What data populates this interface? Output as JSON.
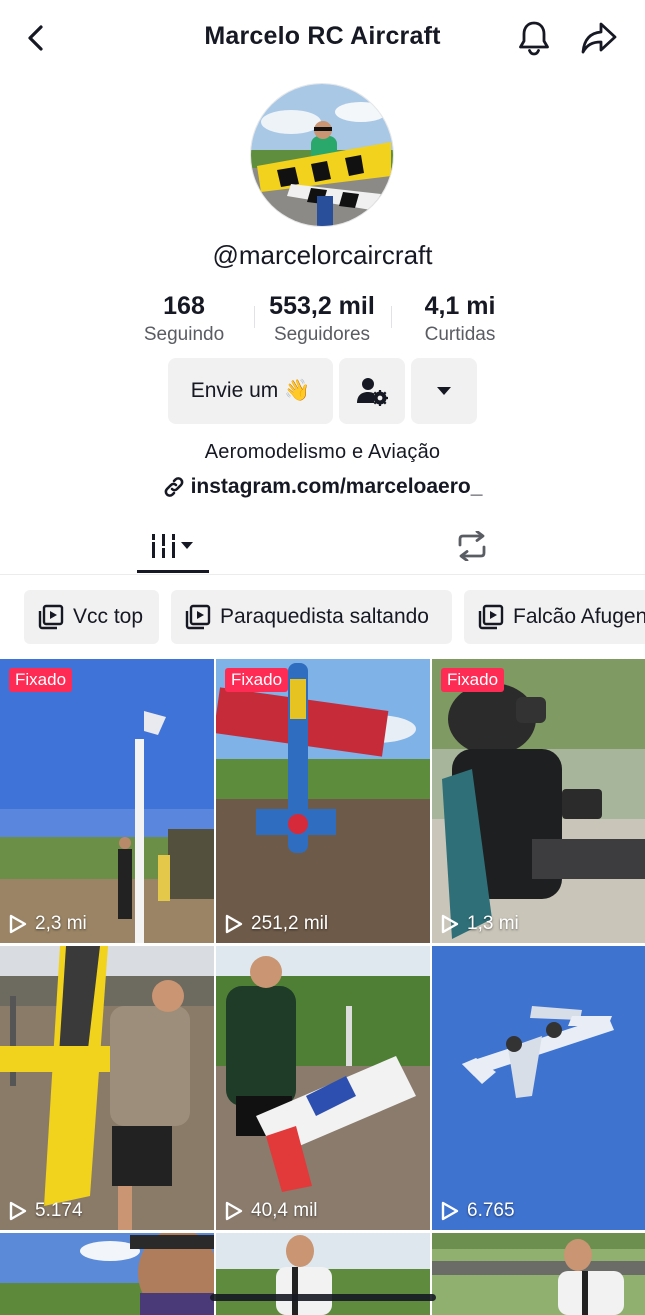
{
  "header": {
    "title": "Marcelo RC Aircraft",
    "back_icon": "chevron-left-icon",
    "bell_icon": "bell-icon",
    "share_icon": "share-arrow-icon"
  },
  "profile": {
    "username": "@marcelorcaircraft",
    "bio": "Aeromodelismo e Aviação",
    "link": "instagram.com/marceloaero_"
  },
  "stats": [
    {
      "value": "168",
      "label": "Seguindo"
    },
    {
      "value": "553,2 mil",
      "label": "Seguidores"
    },
    {
      "value": "4,1 mi",
      "label": "Curtidas"
    }
  ],
  "actions": {
    "message_label": "Envie um 👋",
    "add_friend_icon": "user-gear-icon",
    "more_icon": "caret-down-icon"
  },
  "tabs": {
    "videos_icon": "grid-bars-icon",
    "reposts_icon": "repost-icon"
  },
  "playlists": [
    {
      "label": "Vcc top"
    },
    {
      "label": "Paraquedista saltando"
    },
    {
      "label": "Falcão Afugen"
    }
  ],
  "videos": [
    {
      "pinned": "Fixado",
      "views": "2,3 mi"
    },
    {
      "pinned": "Fixado",
      "views": "251,2 mil"
    },
    {
      "pinned": "Fixado",
      "views": "1,3 mi"
    },
    {
      "views": "5.174"
    },
    {
      "views": "40,4 mil"
    },
    {
      "views": "6.765"
    }
  ],
  "colors": {
    "accent": "#fe2c55",
    "text": "#161823",
    "muted": "#5a5c63",
    "button_bg": "#f1f1f2"
  }
}
